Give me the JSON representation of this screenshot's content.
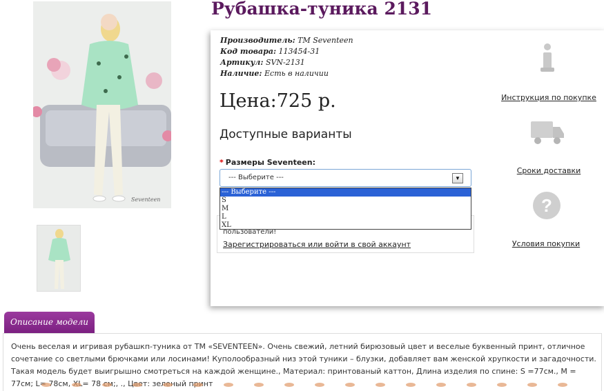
{
  "product": {
    "title": "Рубашка-туника 2131",
    "meta": [
      {
        "label": "Производитель:",
        "value": "TM Seventeen"
      },
      {
        "label": "Код товара:",
        "value": "113454-31"
      },
      {
        "label": "Артикул:",
        "value": "SVN-2131"
      },
      {
        "label": "Наличие:",
        "value": "Есть в наличии"
      }
    ],
    "price_label": "Цена:",
    "price_value": "725 р.",
    "variants_heading": "Доступные варианты",
    "size_label": "Размеры Seventeen:",
    "size_required_mark": "*",
    "size_select": {
      "selected": "--- Выберите ---",
      "options": [
        "--- Выберите ---",
        "S",
        "M",
        "L",
        "XL"
      ]
    },
    "photo_caption": "Seventeen"
  },
  "login": {
    "text": "пользователи!",
    "link": "Зарегистрироваться или войти в свой аккаунт"
  },
  "sidebar": {
    "instructions": "Инструкция по покупке",
    "delivery": "Сроки доставки",
    "conditions": "Условия покупки"
  },
  "description": {
    "tab_label": "Описание модели",
    "text": "Очень веселая и игривая рубашкп-туника от TM «SEVENTEEN». Очень свежий, летний бирюзовый цвет и веселые буквенный принт, отличное сочетание со светлыми брючками или лосинами! Куполообразный низ этой туники – блузки, добавляет вам женской хрупкости и загадочности. Такая модель будет выигрышно смотреться на каждой женщине., Материал: принтованый каттон, Длина изделия по спине: S =77см., M = 77см; L= 78см, XL= 78 см;, ., Цвет: зеленый принт"
  },
  "colors": {
    "title": "#5b1a5e",
    "tab": "#8a2a8e",
    "dropdown_highlight": "#2b62d6"
  }
}
